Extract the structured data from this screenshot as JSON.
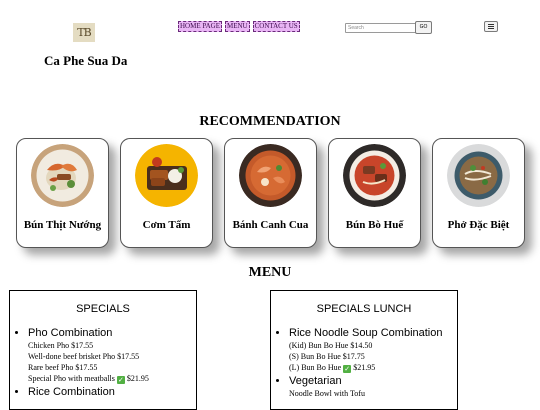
{
  "header": {
    "logo_text": "TB",
    "brand": "Ca Phe Sua Da",
    "nav": [
      "HOME PAGE",
      "MENU",
      "CONTACT US"
    ],
    "search_placeholder": "Search",
    "go_label": "GO",
    "menu_icon": "hamburger-icon"
  },
  "recommendation": {
    "title": "RECOMMENDATION",
    "items": [
      {
        "name": "Bún Thịt Nướng"
      },
      {
        "name": "Cơm Tấm"
      },
      {
        "name": "Bánh Canh Cua"
      },
      {
        "name": "Bún Bò Huế"
      },
      {
        "name": "Phở Đặc Biệt"
      }
    ]
  },
  "menu": {
    "title": "MENU",
    "specials": {
      "title": "SPECIALS",
      "groups": [
        {
          "name": "Pho Combination",
          "items": [
            "Chicken Pho $17.55",
            "Well-done beef brisket Pho $17.55",
            "Rare beef Pho $17.55",
            "Special Pho with meatballs",
            "$21.95"
          ]
        },
        {
          "name": "Rice Combination",
          "items": []
        }
      ]
    },
    "specials_lunch": {
      "title": "SPECIALS LUNCH",
      "groups": [
        {
          "name": "Rice Noodle Soup Combination",
          "items": [
            "(Kid) Bun Bo Hue $14.50",
            "(S) Bun Bo Hue $17.75",
            "(L) Bun Bo Hue",
            "$21.95"
          ]
        },
        {
          "name": "Vegetarian",
          "items": [
            "Noodle Bowl with Tofu"
          ]
        }
      ]
    }
  },
  "colors": {
    "nav_bg": "#e9b5f5",
    "check_green": "#52b043"
  }
}
